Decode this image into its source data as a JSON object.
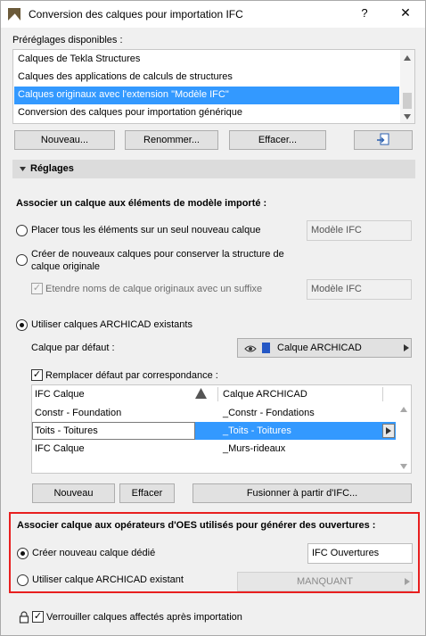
{
  "window": {
    "title": "Conversion des calques pour importation IFC",
    "help_label": "?",
    "close_label": "✕"
  },
  "presets": {
    "label": "Préréglages disponibles :",
    "items": [
      "Calques de Tekla Structures",
      "Calques des applications de calculs de structures",
      "Calques originaux avec l'extension \"Modèle IFC\"",
      "Conversion des calques pour importation générique"
    ],
    "selected_index": 2,
    "buttons": {
      "new": "Nouveau...",
      "rename": "Renommer...",
      "delete": "Effacer..."
    }
  },
  "settings": {
    "header": "Réglages",
    "assign_heading": "Associer un calque aux éléments de modèle importé :",
    "option_single": "Placer tous les éléments sur un seul nouveau calque",
    "option_single_field": "Modèle IFC",
    "option_new_line1": "Créer de nouveaux calques pour conserver la structure de",
    "option_new_line2": "calque originale",
    "extend_names": "Etendre noms de calque originaux avec un suffixe",
    "extend_names_field": "Modèle IFC",
    "option_existing": "Utiliser calques ARCHICAD existants",
    "default_layer_label": "Calque par défaut :",
    "default_layer_value": "Calque ARCHICAD",
    "replace_default": "Remplacer défaut par correspondance :",
    "table": {
      "headers": [
        "IFC Calque",
        "Calque ARCHICAD"
      ],
      "rows": [
        [
          "Constr - Foundation",
          "_Constr - Fondations"
        ],
        [
          "Toits - Toitures",
          "_Toits - Toitures"
        ],
        [
          "IFC Calque",
          "_Murs-rideaux"
        ]
      ],
      "selected_row": 1
    },
    "table_buttons": {
      "new": "Nouveau",
      "delete": "Effacer",
      "merge": "Fusionner à partir d'IFC..."
    }
  },
  "openings": {
    "heading": "Associer calque aux opérateurs d'OES utilisés pour générer des ouvertures :",
    "option_new": "Créer nouveau calque dédié",
    "option_new_field": "IFC Ouvertures",
    "option_existing": "Utiliser calque ARCHICAD existant",
    "option_existing_value": "MANQUANT"
  },
  "footer": {
    "lock_label": "Verrouiller calques affectés après importation"
  },
  "colors": {
    "selection": "#3399ff",
    "highlight_border": "#e81f1f"
  }
}
